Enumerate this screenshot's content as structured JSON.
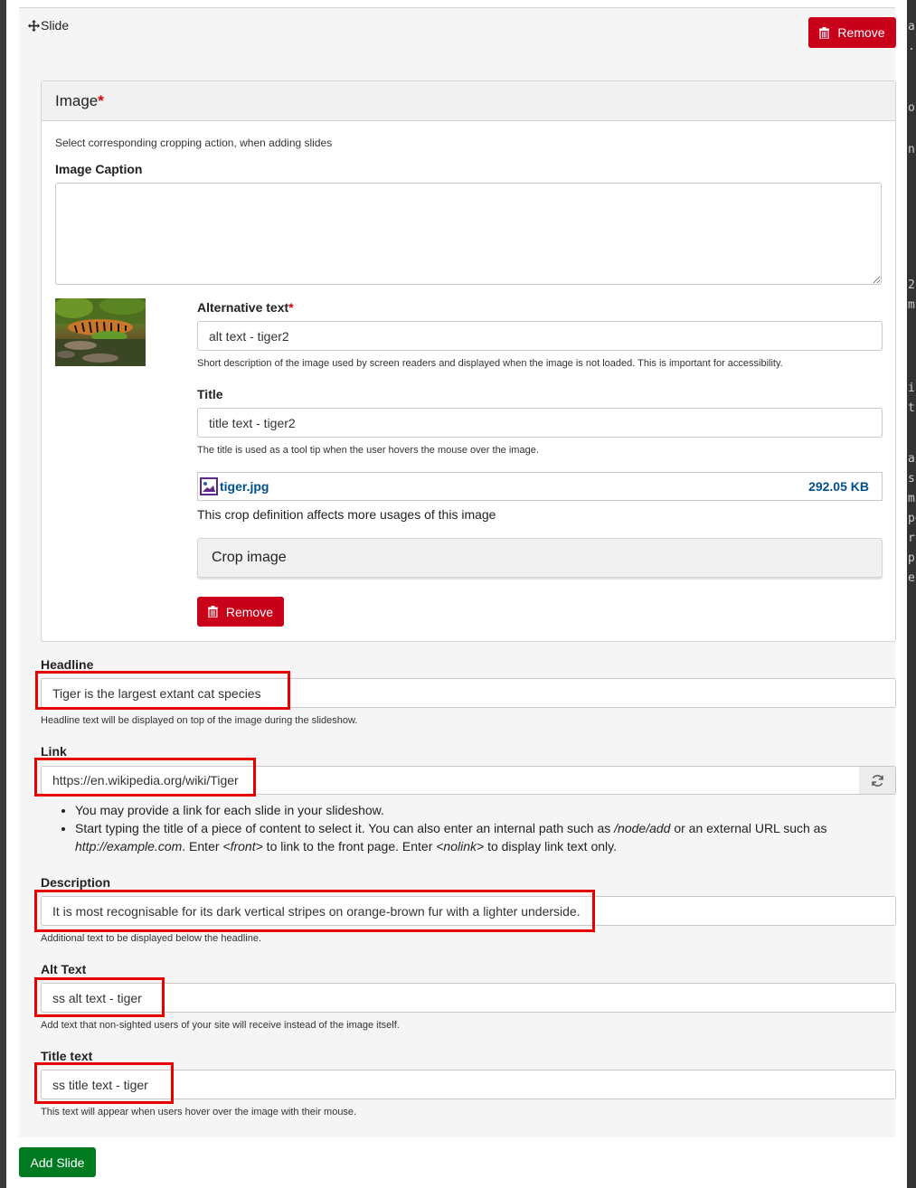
{
  "slide": {
    "label": "Slide",
    "remove_label": "Remove"
  },
  "image": {
    "legend": "Image",
    "required_mark": "*",
    "cropping_note": "Select corresponding cropping action, when adding slides",
    "caption_label": "Image Caption",
    "caption_value": "",
    "thumbnail_alt": "tiger thumbnail",
    "alt_label": "Alternative text",
    "alt_value": "alt text - tiger2",
    "alt_help": "Short description of the image used by screen readers and displayed when the image is not loaded. This is important for accessibility.",
    "title_label": "Title",
    "title_value": "title text - tiger2",
    "title_help": "The title is used as a tool tip when the user hovers the mouse over the image.",
    "file_name": "tiger.jpg",
    "file_size": "292.05 KB",
    "crop_note": "This crop definition affects more usages of this image",
    "crop_label": "Crop image",
    "remove_label": "Remove"
  },
  "headline": {
    "label": "Headline",
    "value": "Tiger is the largest extant cat species",
    "help": "Headline text will be displayed on top of the image during the slideshow."
  },
  "link": {
    "label": "Link",
    "value": "https://en.wikipedia.org/wiki/Tiger",
    "help_1": "You may provide a link for each slide in your slideshow.",
    "help_2_a": "Start typing the title of a piece of content to select it. You can also enter an internal path such as ",
    "help_2_b": "/node/add",
    "help_2_c": " or an external URL such as ",
    "help_2_d": "http://example.com",
    "help_2_e": ". Enter ",
    "help_2_f": "<front>",
    "help_2_g": " to link to the front page. Enter ",
    "help_2_h": "<nolink>",
    "help_2_i": " to display link text only."
  },
  "description": {
    "label": "Description",
    "value": "It is most recognisable for its dark vertical stripes on orange-brown fur with a lighter underside.",
    "help": "Additional text to be displayed below the headline."
  },
  "alt_text": {
    "label": "Alt Text",
    "value": "ss alt text - tiger",
    "help": "Add text that non-sighted users of your site will receive instead of the image itself."
  },
  "title_text": {
    "label": "Title text",
    "value": "ss title text - tiger",
    "help": "This text will appear when users hover over the image with their mouse."
  },
  "add_slide_label": "Add Slide",
  "colors": {
    "danger": "#c9001a",
    "success": "#007a20",
    "highlight": "#e80000",
    "link": "#00508c"
  },
  "right_strip_fragments": [
    "a",
    ".p",
    "or",
    "n's",
    "2",
    "m",
    "i",
    "t",
    "a",
    "s",
    "m",
    "pe",
    "rr",
    "pc",
    "e"
  ]
}
